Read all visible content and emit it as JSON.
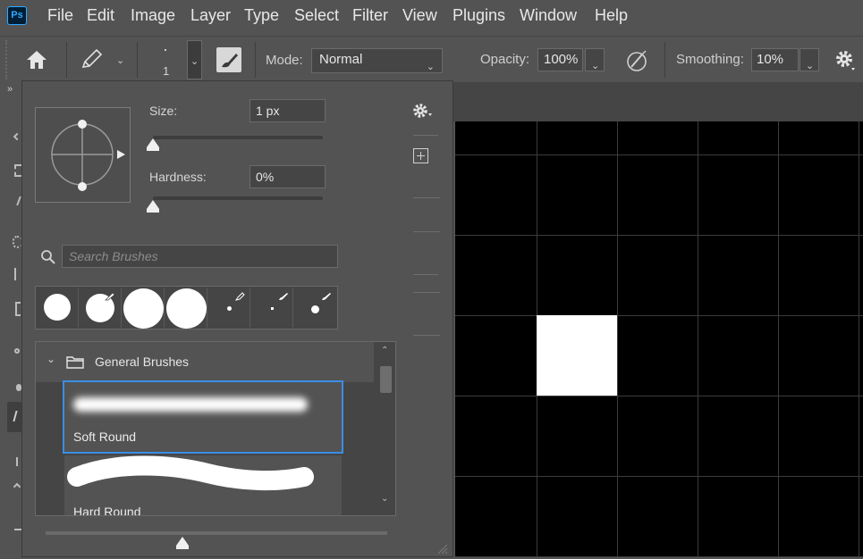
{
  "app": {
    "logo_text": "Ps",
    "accent": "#31a8ff"
  },
  "menu": [
    "File",
    "Edit",
    "Image",
    "Layer",
    "Type",
    "Select",
    "Filter",
    "View",
    "Plugins",
    "Window",
    "Help"
  ],
  "options_bar": {
    "brush_size_value": "1",
    "mode_label": "Mode:",
    "mode_value": "Normal",
    "opacity_label": "Opacity:",
    "opacity_value": "100%",
    "smoothing_label": "Smoothing:",
    "smoothing_value": "10%",
    "icons": [
      "home-icon",
      "pencil-icon",
      "toggle-brush-panel-icon",
      "airbrush-pressure-icon",
      "gear-icon"
    ]
  },
  "brush_panel": {
    "size_label": "Size:",
    "size_value": "1 px",
    "size_slider_fraction": 0.0,
    "hardness_label": "Hardness:",
    "hardness_value": "0%",
    "hardness_slider_fraction": 0.0,
    "search_placeholder": "Search Brushes",
    "group_name": "General Brushes",
    "brushes": [
      {
        "name": "Soft Round",
        "selected": true
      },
      {
        "name": "Hard Round",
        "selected": false
      }
    ],
    "preview_slider_fraction": 0.4,
    "selected_color": "#3a8ee6"
  }
}
